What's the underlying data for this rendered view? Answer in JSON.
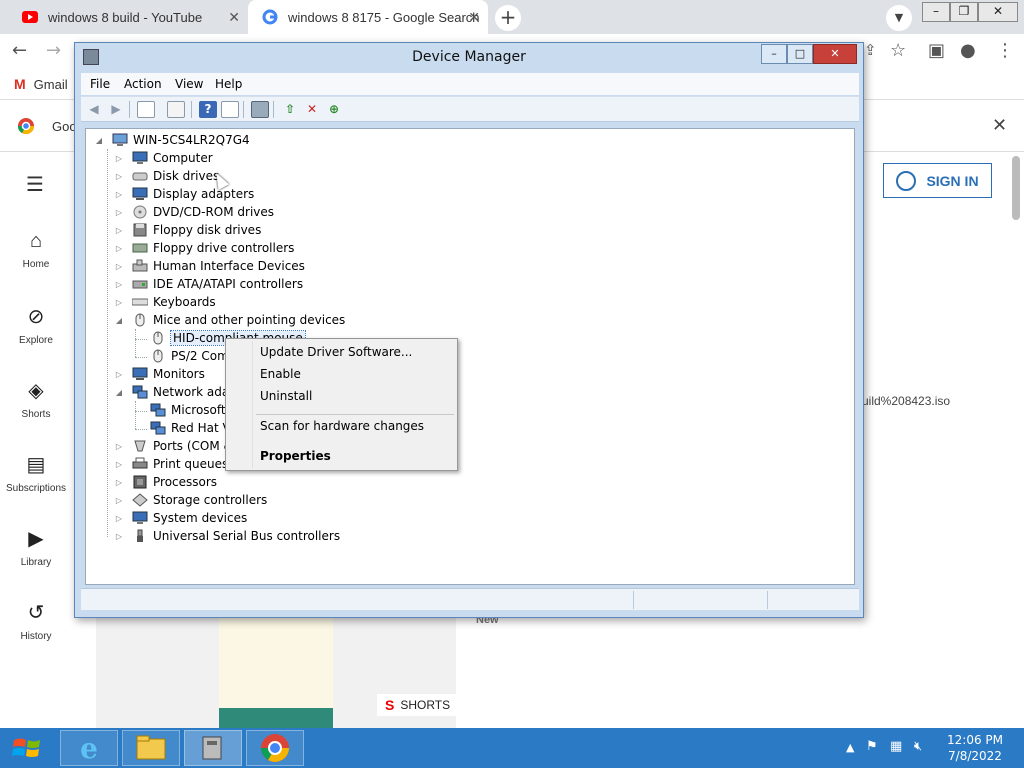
{
  "chrome": {
    "tabs": [
      {
        "title": "windows 8 build - YouTube",
        "active": false
      },
      {
        "title": "windows 8 8175 - Google Search",
        "active": true
      }
    ],
    "bookmarks": {
      "gmail": "Gmail"
    },
    "infobar": {
      "text": "Goo"
    }
  },
  "youtube": {
    "nav": [
      {
        "label": "Home",
        "icon": "home-icon"
      },
      {
        "label": "Explore",
        "icon": "compass-icon"
      },
      {
        "label": "Shorts",
        "icon": "shorts-icon"
      },
      {
        "label": "Subscriptions",
        "icon": "subscriptions-icon"
      },
      {
        "label": "Library",
        "icon": "library-icon"
      },
      {
        "label": "History",
        "icon": "history-icon"
      }
    ],
    "sign_in": "SIGN IN",
    "url_fragment": "uild%208423.iso",
    "shorts_badge": "SHORTS",
    "new_label": "New"
  },
  "device_manager": {
    "title": "Device Manager",
    "menu": [
      "File",
      "Action",
      "View",
      "Help"
    ],
    "root": "WIN-5CS4LR2Q7G4",
    "nodes": [
      {
        "label": "Computer",
        "icon": "computer-icon"
      },
      {
        "label": "Disk drives",
        "icon": "disk-icon"
      },
      {
        "label": "Display adapters",
        "icon": "monitor-icon"
      },
      {
        "label": "DVD/CD-ROM drives",
        "icon": "dvd-icon"
      },
      {
        "label": "Floppy disk drives",
        "icon": "floppy-icon"
      },
      {
        "label": "Floppy drive controllers",
        "icon": "controller-icon"
      },
      {
        "label": "Human Interface Devices",
        "icon": "hid-icon"
      },
      {
        "label": "IDE ATA/ATAPI controllers",
        "icon": "ide-icon"
      },
      {
        "label": "Keyboards",
        "icon": "keyboard-icon"
      },
      {
        "label": "Mice and other pointing devices",
        "icon": "mouse-icon",
        "expanded": true,
        "children": [
          "HID-compliant mouse",
          "PS/2 Comp"
        ]
      },
      {
        "label": "Monitors",
        "icon": "monitor-icon"
      },
      {
        "label": "Network adapt",
        "icon": "network-icon",
        "expanded": true,
        "children": [
          "Microsoft K",
          "Red Hat Vir"
        ]
      },
      {
        "label": "Ports (COM &",
        "icon": "port-icon"
      },
      {
        "label": "Print queues",
        "icon": "printer-icon"
      },
      {
        "label": "Processors",
        "icon": "cpu-icon"
      },
      {
        "label": "Storage controllers",
        "icon": "storage-icon"
      },
      {
        "label": "System devices",
        "icon": "system-icon"
      },
      {
        "label": "Universal Serial Bus controllers",
        "icon": "usb-icon"
      }
    ]
  },
  "context_menu": {
    "items": [
      "Update Driver Software...",
      "Enable",
      "Uninstall",
      "Scan for hardware changes",
      "Properties"
    ]
  },
  "taskbar": {
    "time": "12:06 PM",
    "date": "7/8/2022"
  },
  "colors": {
    "taskbar": "#2a7ac6",
    "window_frame": "#c9dcef",
    "youtube_red": "#ff0000",
    "link_blue": "#2a6fb5"
  }
}
